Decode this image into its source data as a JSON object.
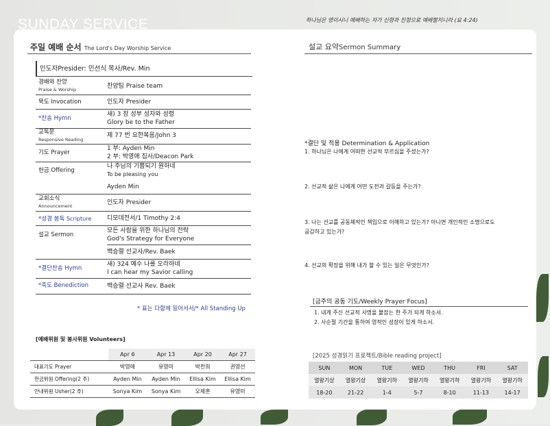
{
  "header": {
    "title": "SUNDAY SERVICE",
    "verse": "하나님은 영이시니 예배하는 자가 신령과 진정으로 예배할지니라 (요 4:24)"
  },
  "order": {
    "title_ko": "주일 예배 순서",
    "title_en": "The Lord's Day Worship Service",
    "presider": "인도자Presider: 민선식 목사/Rev. Min",
    "items": [
      {
        "k1": "경배와 찬양",
        "k2": "Praise & Worship",
        "v1": "찬양팀 Praise team",
        "v2": ""
      },
      {
        "k1": "묵도 Invocation",
        "k2": "",
        "v1": "인도자 Presider",
        "v2": ""
      },
      {
        "k1": "*찬송 Hymn",
        "k2": "",
        "v1": "새) 3 장 성부 성자와 성령",
        "v2": "Glory be to the Father"
      },
      {
        "k1": "교독문",
        "k2": "Responsive Reading",
        "v1": "제 77 번 요한복음/John 3",
        "v2": ""
      },
      {
        "k1": "기도 Prayer",
        "k2": "",
        "v1": "1 부: Ayden Min",
        "v2": "2 부: 박영애 집사/Deacon Park"
      },
      {
        "k1": "헌금 Offering",
        "k2": "",
        "v1": "나 주님의 기쁨되기 원하네",
        "v2": "To be pleasing you"
      },
      {
        "k1": "",
        "k2": "",
        "v1": "Ayden Min",
        "v2": ""
      },
      {
        "k1": "교회소식",
        "k2": "Announcement",
        "v1": "인도자 Presider",
        "v2": ""
      },
      {
        "k1": "*성경 봉독",
        "k2": "Scripture",
        "v1": "디모데전서/1 Timothy 2:4",
        "v2": ""
      },
      {
        "k1": "설교 Sermon",
        "k2": "",
        "v1": "모든 사람을 위한 하나님의 전략",
        "v2": "God's Strategy for Everyone"
      },
      {
        "k1": "",
        "k2": "",
        "v1": "백승렬 선교사/Rev. Baek",
        "v2": ""
      },
      {
        "k1": "*결단찬송 Hymn",
        "k2": "",
        "v1": "새) 324 예수 나를 오라하네",
        "v2": "I can hear my Savior calling"
      },
      {
        "k1": "*축도 Benediction",
        "k2": "",
        "v1": "백승렬 선교사 Rev. Baek",
        "v2": ""
      }
    ],
    "standing_note": "* 표는 다함께 일어서서/* All Standing Up"
  },
  "volunteers": {
    "title": "[예배위원 및 봉사위원 Volunteers]",
    "dates": [
      "Apr 6",
      "Apr 13",
      "Apr 20",
      "Apr 27"
    ],
    "rows": [
      {
        "label": "대표기도 Prayer",
        "cells": [
          "박영애",
          "유영미",
          "박천희",
          "권영선"
        ]
      },
      {
        "label": "헌금위원 Offering(2 주)",
        "cells": [
          "Ayden Min",
          "Ayden Min",
          "Ellisa Kim",
          "Ellisa Kim"
        ]
      },
      {
        "label": "안내위원 Usher(2 주)",
        "cells": [
          "Sonya Kim",
          "Sonya Kim",
          "오제훈",
          "유영미"
        ]
      }
    ]
  },
  "sermon": {
    "title_ko": "설교 요약",
    "title_en": "Sermon Summary",
    "decision_title": "*결단 및 적용 Determination & Application",
    "q1": "1. 하나님은 나에게 어떠한 선교적 부르심을 주셨는가?",
    "q2": "2. 선교적 삶은 나에게 어떤 도전과 갈등을 주는가?",
    "q3a": "3. 나는 선교를 공동체적인 책임으로 이해하고 있는가? 아니면 개인적인 소명으로도",
    "q3b": "공감하고 있는가?",
    "q4": "4. 선교의 확장을 위해 내가 할 수 있는 일은 무엇인가?"
  },
  "prayer": {
    "title": "[금주의 공동 기도/Weekly Prayer Focus]",
    "p1": "1. 내게 주신 선교적 사명을 붙잡는 한 주가 되게 하소서.",
    "p2": "2. 사순절 기간을 통하여 영적인 성장이 있게 하소서."
  },
  "bible": {
    "title": "[2025 성경읽기 프로젝트/Bible reading project]",
    "days": [
      "SUN",
      "MON",
      "TUE",
      "WED",
      "THU",
      "FRI",
      "SAT"
    ],
    "label": [
      "열왕기상",
      "열왕기상",
      "열왕기하",
      "열왕기하",
      "열왕기하",
      "열왕기하",
      "열왕기하"
    ],
    "chapters": [
      "18-20",
      "21-22",
      "1-4",
      "5-7",
      "8-10",
      "11-13",
      "14-17"
    ]
  }
}
